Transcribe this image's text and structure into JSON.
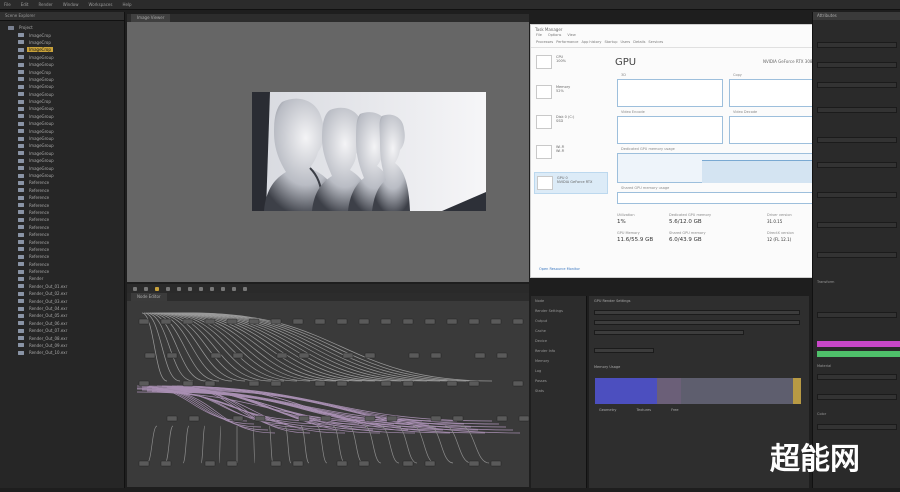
{
  "menubar": {
    "items": [
      "File",
      "Edit",
      "Render",
      "Window",
      "Workspaces",
      "Help"
    ]
  },
  "left_panel": {
    "tab": "Scene Explorer",
    "root": "Project",
    "selected_index": 2,
    "items": [
      "ImageCrop",
      "ImageCrop",
      "ImageCrop",
      "ImageGroup",
      "ImageGroup",
      "ImageCrop",
      "ImageGroup",
      "ImageGroup",
      "ImageGroup",
      "ImageCrop",
      "ImageGroup",
      "ImageGroup",
      "ImageGroup",
      "ImageGroup",
      "ImageGroup",
      "ImageGroup",
      "ImageGroup",
      "ImageGroup",
      "ImageGroup",
      "ImageGroup",
      "Reference",
      "Reference",
      "Reference",
      "Reference",
      "Reference",
      "Reference",
      "Reference",
      "Reference",
      "Reference",
      "Reference",
      "Reference",
      "Reference",
      "Reference",
      "Render",
      "Render_Out_01.exr",
      "Render_Out_02.exr",
      "Render_Out_03.exr",
      "Render_Out_04.exr",
      "Render_Out_05.exr",
      "Render_Out_06.exr",
      "Render_Out_07.exr",
      "Render_Out_08.exr",
      "Render_Out_09.exr",
      "Render_Out_10.exr"
    ]
  },
  "viewer": {
    "tab": "Image Viewer"
  },
  "task_manager": {
    "title": "Task Manager",
    "menu": [
      "File",
      "Options",
      "View"
    ],
    "tabs": [
      "Processes",
      "Performance",
      "App history",
      "Startup",
      "Users",
      "Details",
      "Services"
    ],
    "sidebar": [
      {
        "label": "CPU",
        "sub": "100%"
      },
      {
        "label": "Memory",
        "sub": "52%"
      },
      {
        "label": "Disk 0 (C:)",
        "sub": "SSD"
      },
      {
        "label": "Wi-Fi",
        "sub": "Wi-Fi"
      },
      {
        "label": "GPU 0",
        "sub": "NVIDIA GeForce RTX"
      }
    ],
    "heading": "GPU",
    "gpu_name": "NVIDIA GeForce RTX 3080 Ti",
    "graph_labels": [
      "3D",
      "Copy",
      "Video Encode",
      "Video Decode",
      "Dedicated GPU memory usage",
      "Shared GPU memory usage"
    ],
    "stats": [
      {
        "label": "Utilization",
        "value": "1%"
      },
      {
        "label": "Dedicated GPU memory",
        "value": "5.6/12.0 GB"
      },
      {
        "label": "Driver version",
        "value": "31.0.15"
      },
      {
        "label": "GPU Memory",
        "value": "11.6/55.9 GB"
      },
      {
        "label": "Shared GPU memory",
        "value": "6.0/43.9 GB"
      },
      {
        "label": "DirectX version",
        "value": "12 (FL 12.1)"
      }
    ],
    "footer": "Open Resource Monitor"
  },
  "node_editor": {
    "tab": "Node Editor",
    "tab2": "Graph"
  },
  "properties": {
    "items": [
      "Node",
      "Render Settings",
      "Output",
      "Cache",
      "Device",
      "Render Info",
      "Memory",
      "Log",
      "Passes",
      "Stats"
    ]
  },
  "settings": {
    "header": "GPU Render Settings",
    "section": "Memory Usage",
    "legend": [
      "Geometry",
      "Textures",
      "Free"
    ]
  },
  "right_panel": {
    "tab": "Attributes",
    "labels": [
      "Transform",
      "Material",
      "Color"
    ]
  },
  "colors": {
    "accent": "#c9a23a",
    "magenta": "#c847c8",
    "green": "#4fc06a",
    "bar_blue": "#4c4fbf",
    "bar_gold": "#b89a44"
  },
  "watermark": "超能网"
}
